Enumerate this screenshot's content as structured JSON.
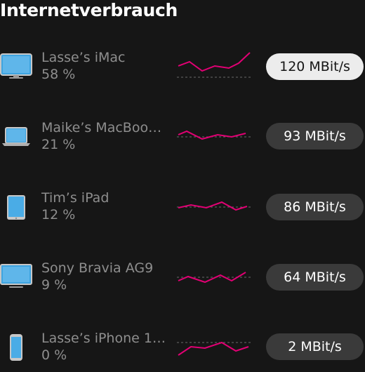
{
  "header": {
    "title": "Internetverbrauch"
  },
  "colors": {
    "accent": "#e20074",
    "pill": "#3a3a3a",
    "pill_active": "#ececec",
    "text_muted": "#8e8e8e"
  },
  "devices": [
    {
      "name": "Lasse’s iMac",
      "share": "58 %",
      "speed": "120 MBit/s",
      "icon": "imac-icon"
    },
    {
      "name": "Maike’s MacBoo…",
      "share": "21 %",
      "speed": "93 MBit/s",
      "icon": "laptop-icon"
    },
    {
      "name": "Tim’s iPad",
      "share": "12 %",
      "speed": "86 MBit/s",
      "icon": "tablet-icon"
    },
    {
      "name": "Sony Bravia AG9",
      "share": "9 %",
      "speed": "64 MBit/s",
      "icon": "tv-icon"
    },
    {
      "name": "Lasse’s iPhone 1…",
      "share": "0 %",
      "speed": "2 MBit/s",
      "icon": "phone-icon"
    }
  ]
}
